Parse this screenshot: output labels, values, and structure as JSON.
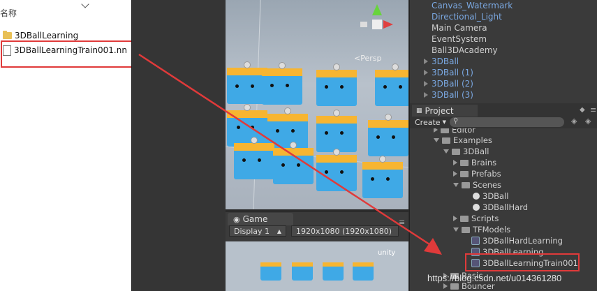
{
  "explorer": {
    "header_label": "名称",
    "items": [
      {
        "name": "3DBallLearning",
        "type": "folder"
      },
      {
        "name": "3DBallLearningTrain001.nn",
        "type": "file"
      }
    ]
  },
  "scene": {
    "projection_label": "<Persp"
  },
  "game": {
    "tab_label": "Game",
    "display_select": "Display 1",
    "resolution_select": "1920x1080 (1920x1080)",
    "logo_text": "unity"
  },
  "hierarchy": {
    "items": [
      {
        "label": "Canvas_Watermark",
        "color": "#7aa7e0"
      },
      {
        "label": "Directional_Light",
        "color": "#7aa7e0"
      },
      {
        "label": "Main Camera",
        "color": "#cfcfcf"
      },
      {
        "label": "EventSystem",
        "color": "#cfcfcf"
      },
      {
        "label": "Ball3DAcademy",
        "color": "#cfcfcf"
      },
      {
        "label": "3DBall",
        "color": "#7aa7e0"
      },
      {
        "label": "3DBall (1)",
        "color": "#7aa7e0"
      },
      {
        "label": "3DBall (2)",
        "color": "#7aa7e0"
      },
      {
        "label": "3DBall (3)",
        "color": "#7aa7e0"
      }
    ]
  },
  "project": {
    "tab_label": "Project",
    "create_label": "Create",
    "tree": [
      {
        "label": "Editor"
      },
      {
        "label": "Examples"
      },
      {
        "label": "3DBall"
      },
      {
        "label": "Brains"
      },
      {
        "label": "Prefabs"
      },
      {
        "label": "Scenes"
      },
      {
        "label": "3DBall"
      },
      {
        "label": "3DBallHard"
      },
      {
        "label": "Scripts"
      },
      {
        "label": "TFModels"
      },
      {
        "label": "3DBallHardLearning"
      },
      {
        "label": "3DBallLearning"
      },
      {
        "label": "3DBallLearningTrain001"
      },
      {
        "label": "Basic"
      },
      {
        "label": "Bouncer"
      }
    ]
  },
  "watermark": "https://blog.csdn.net/u014361280",
  "colors": {
    "annotation_red": "#e03a3a",
    "cube_blue": "#3fa9e6",
    "cube_band": "#f7b531"
  }
}
